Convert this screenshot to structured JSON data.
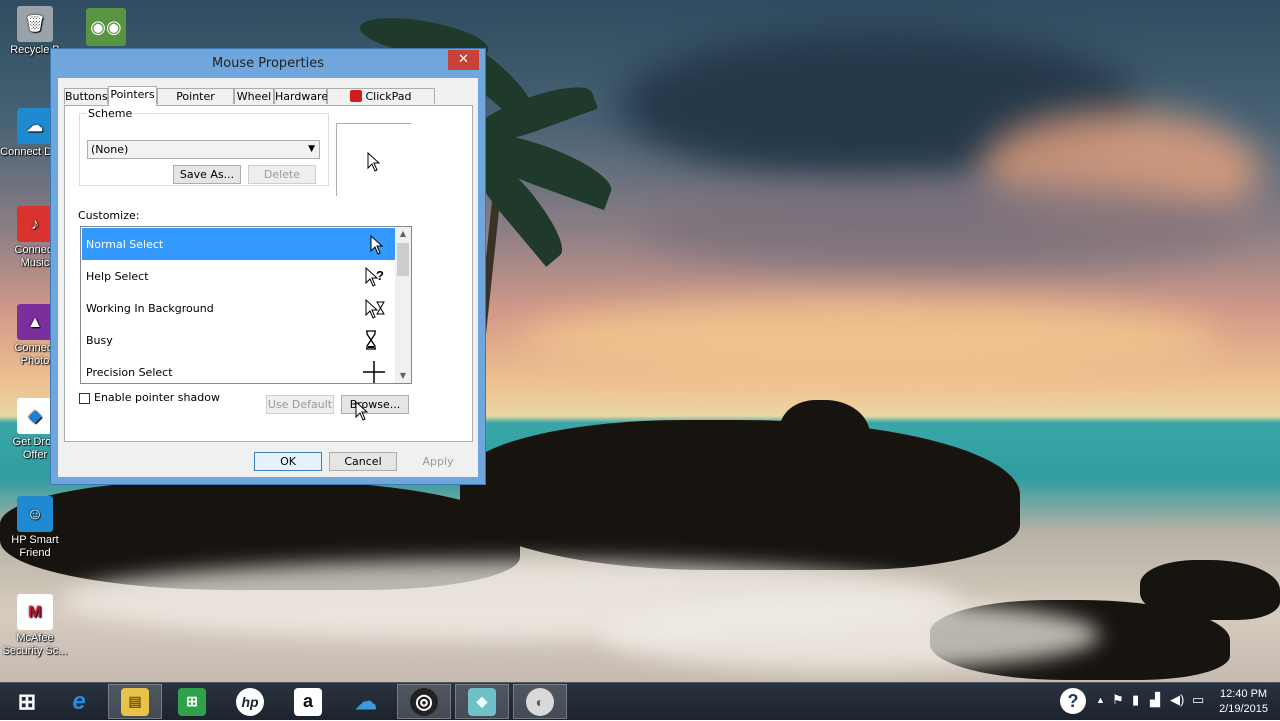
{
  "desktop": {
    "icons": [
      {
        "label": "Recycle B",
        "icon": "recycle-bin-icon",
        "color": "#9aa3aa"
      },
      {
        "label": "Connect Drive",
        "icon": "cloud-drive-icon",
        "color": "#1f8ad0"
      },
      {
        "label": "Connect Music",
        "icon": "music-icon",
        "color": "#d8332e"
      },
      {
        "label": "Connect Photo",
        "icon": "photo-icon",
        "color": "#7a2f9c"
      },
      {
        "label": "Get Drop Offer",
        "icon": "dropbox-icon",
        "color": "#1f81d6"
      },
      {
        "label": "HP Smart Friend",
        "icon": "hp-smart-friend-icon",
        "color": "#1f8ad0"
      },
      {
        "label": "McAfee Security Sc...",
        "icon": "mcafee-icon",
        "color": "#c8102e"
      }
    ],
    "extra_icon": {
      "icon": "tripadvisor-icon",
      "color": "#589442"
    }
  },
  "dialog": {
    "title": "Mouse Properties",
    "close_glyph": "✕",
    "tabs": [
      {
        "label": "Buttons",
        "active": false
      },
      {
        "label": "Pointers",
        "active": true
      },
      {
        "label": "Pointer Options",
        "active": false
      },
      {
        "label": "Wheel",
        "active": false
      },
      {
        "label": "Hardware",
        "active": false
      },
      {
        "label": "ClickPad Settings",
        "active": false
      }
    ],
    "scheme": {
      "label": "Scheme",
      "value": "(None)",
      "save_as": "Save As...",
      "delete": "Delete"
    },
    "customize_label": "Customize:",
    "cursors": [
      {
        "name": "Normal Select",
        "icon": "arrow-cursor-icon",
        "selected": true
      },
      {
        "name": "Help Select",
        "icon": "help-cursor-icon",
        "selected": false
      },
      {
        "name": "Working In Background",
        "icon": "working-cursor-icon",
        "selected": false
      },
      {
        "name": "Busy",
        "icon": "hourglass-cursor-icon",
        "selected": false
      },
      {
        "name": "Precision Select",
        "icon": "crosshair-cursor-icon",
        "selected": false
      }
    ],
    "shadow_label": "Enable pointer shadow",
    "shadow_checked": false,
    "use_default": "Use Default",
    "browse": "Browse...",
    "ok": "OK",
    "cancel": "Cancel",
    "apply": "Apply",
    "selection_color": "#3399ff"
  },
  "taskbar": {
    "items": [
      {
        "icon": "windows-start-icon",
        "color": "transparent",
        "glyph": "⊞",
        "active": false
      },
      {
        "icon": "internet-explorer-icon",
        "color": "#1e90e0",
        "glyph": "e",
        "active": false
      },
      {
        "icon": "file-explorer-icon",
        "color": "#e8c24a",
        "glyph": "▤",
        "active": true
      },
      {
        "icon": "store-icon",
        "color": "#2fa14a",
        "glyph": "⊞",
        "active": false
      },
      {
        "icon": "hp-icon",
        "color": "#ffffff",
        "glyph": "hp",
        "active": false
      },
      {
        "icon": "amazon-icon",
        "color": "#ffffff",
        "glyph": "a",
        "active": false
      },
      {
        "icon": "cloud-icon",
        "color": "#3b9ad9",
        "glyph": "☁",
        "active": false
      },
      {
        "icon": "recorder-icon",
        "color": "#222222",
        "glyph": "◎",
        "active": false
      },
      {
        "icon": "glass-icon",
        "color": "#6fc0c8",
        "glyph": "◆",
        "active": false
      },
      {
        "icon": "mouse-icon",
        "color": "#d9d9d9",
        "glyph": "◐",
        "active": true
      }
    ],
    "clock_time": "12:40 PM",
    "clock_date": "2/19/2015"
  }
}
